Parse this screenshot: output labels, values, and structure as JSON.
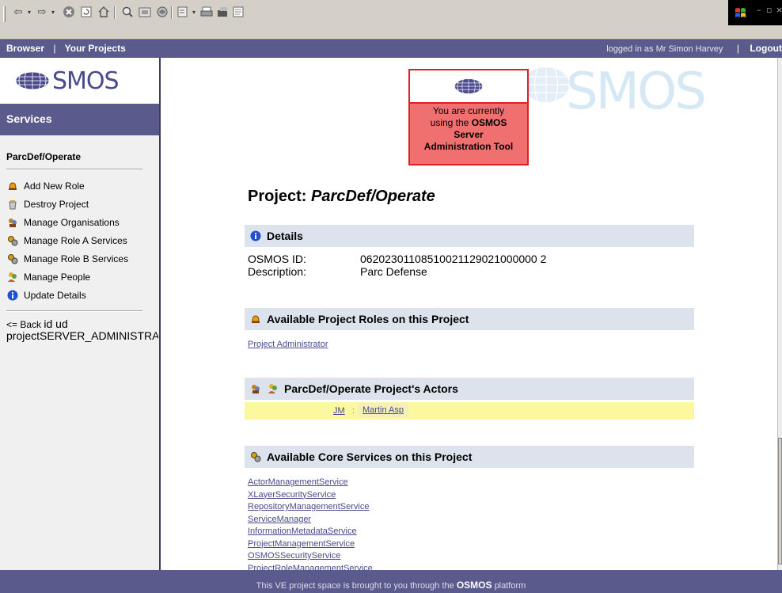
{
  "nav": {
    "browser": "Browser",
    "separator": "|",
    "your_projects": "Your Projects",
    "logged_in": "logged in as Mr Simon Harvey",
    "logout": "Logout"
  },
  "logo": {
    "text": "SMOS"
  },
  "sidebar": {
    "header": "Services",
    "project": "ParcDef/Operate",
    "items": [
      {
        "label": "Add New Role",
        "icon": "bell-icon"
      },
      {
        "label": "Destroy Project",
        "icon": "trash-icon"
      },
      {
        "label": "Manage Organisations",
        "icon": "organisation-icon"
      },
      {
        "label": "Manage Role A Services",
        "icon": "gears-icon"
      },
      {
        "label": "Manage Role B Services",
        "icon": "gears-icon"
      },
      {
        "label": "Manage People",
        "icon": "people-icon"
      },
      {
        "label": "Update Details",
        "icon": "info-icon"
      }
    ],
    "back_prefix": "<= Back",
    "back_id": "id ud",
    "back_project": "projectSERVER_ADMINISTRATOR"
  },
  "banner": {
    "bg_text": "SMOS",
    "admin_line1": "You are currently",
    "admin_line2": "using the",
    "admin_bold1": "OSMOS",
    "admin_bold2": "Server",
    "admin_bold3": "Administration Tool"
  },
  "project": {
    "title_prefix": "Project:",
    "title_name": "ParcDef/Operate"
  },
  "details": {
    "heading": "Details",
    "osmos_id_label": "OSMOS ID:",
    "osmos_id_value": "06202301108510021129021000000 2",
    "description_label": "Description:",
    "description_value": "Parc Defense"
  },
  "roles": {
    "heading": "Available Project Roles on this Project",
    "items": [
      "Project Administrator"
    ]
  },
  "actors": {
    "heading": "ParcDef/Operate Project's Actors",
    "rows": [
      {
        "abbr": "JM",
        "colon": ":",
        "name": "Martin Asp"
      }
    ]
  },
  "services": {
    "heading": "Available Core Services on this Project",
    "items": [
      "ActorManagementService",
      "XLayerSecurityService",
      "RepositoryManagementService",
      "ServiceManager",
      "InformationMetadataService",
      "ProjectManagementService",
      "OSMOSSecurityService",
      "ProjectRoleManagementService"
    ]
  },
  "footer": {
    "text": "This VE project space is brought to you through the",
    "brand": "OSMOS",
    "suffix": "platform"
  },
  "colors": {
    "nav_bg": "#5a5a8c",
    "section_bg": "#dde3ec",
    "admin_red": "#e02020",
    "admin_fill": "#f07070",
    "actor_row": "#fcf8a0",
    "link": "#4a4a8c"
  }
}
